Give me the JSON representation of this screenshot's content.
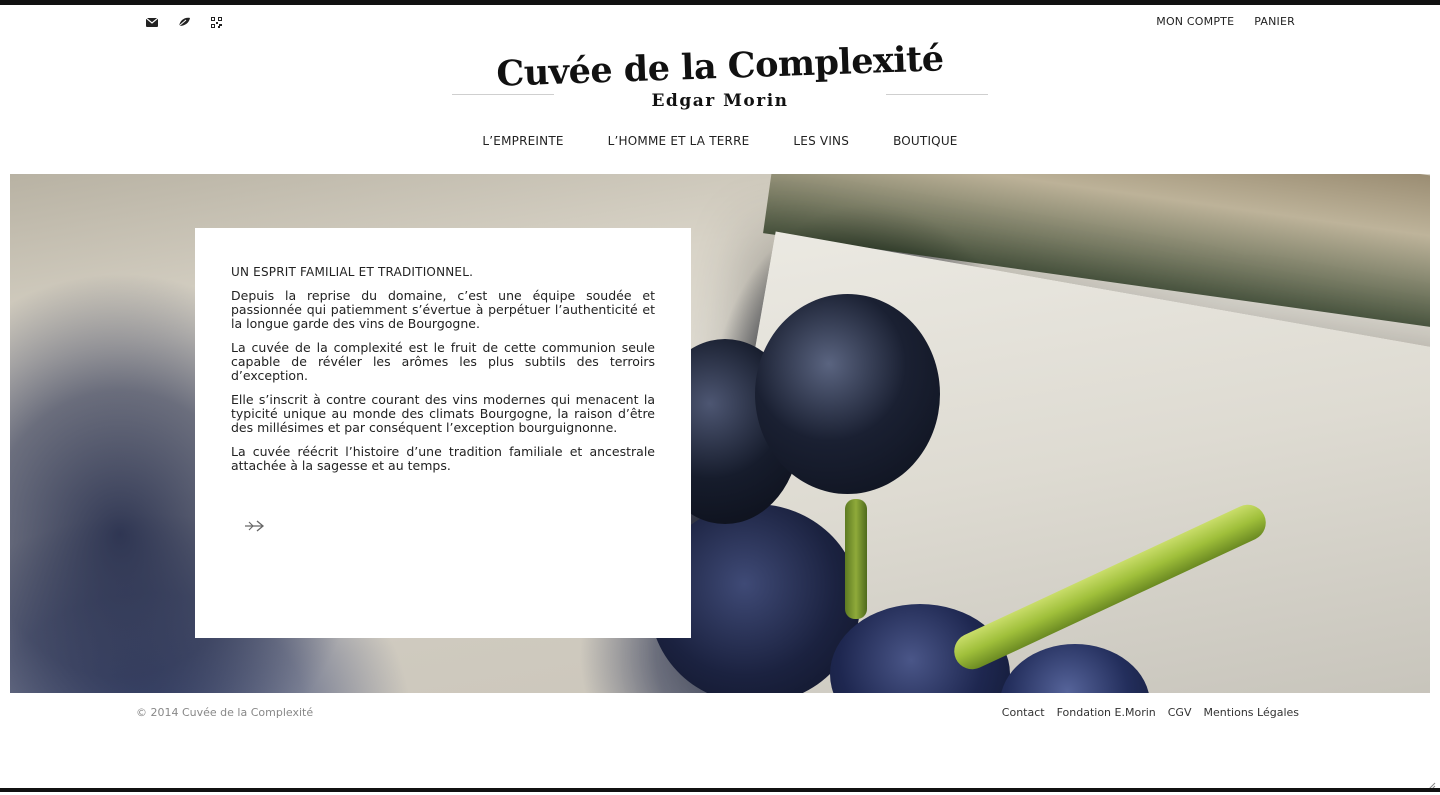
{
  "header": {
    "icons": [
      "envelope-icon",
      "leaf-icon",
      "qr-code-icon"
    ],
    "account_links": [
      "MON COMPTE",
      "PANIER"
    ]
  },
  "logo": {
    "title": "Cuvée de la Complexité",
    "subtitle": "Edgar Morin"
  },
  "nav": {
    "items": [
      "L’EMPREINTE",
      "L’HOMME ET LA TERRE",
      "LES VINS",
      "BOUTIQUE"
    ]
  },
  "content": {
    "heading": "UN ESPRIT FAMILIAL ET TRADITIONNEL.",
    "paragraphs": [
      "Depuis la reprise du domaine, c’est une équipe soudée et passionnée qui patiemment s’évertue à perpétuer l’authenticité et la longue garde des vins de Bourgogne.",
      "La cuvée de la complexité est le fruit de cette communion seule capable de révéler les arômes les plus subtils des terroirs d’exception.",
      "Elle s’inscrit à contre courant des vins modernes qui menacent la typicité unique au monde des climats Bourgogne, la raison d’être des millésimes et par conséquent l’exception bourguignonne.",
      "La cuvée réécrit l’histoire d’une tradition familiale et ancestrale attachée à la sagesse et au temps."
    ],
    "more_icon": "arrow-right-icon"
  },
  "footer": {
    "copyright": "© 2014 Cuvée de la Complexité",
    "links": [
      "Contact",
      "Fondation E.Morin",
      "CGV",
      "Mentions Légales"
    ]
  },
  "colors": {
    "text": "#222222",
    "muted": "#888888",
    "background": "#ffffff",
    "frame": "#111111"
  }
}
